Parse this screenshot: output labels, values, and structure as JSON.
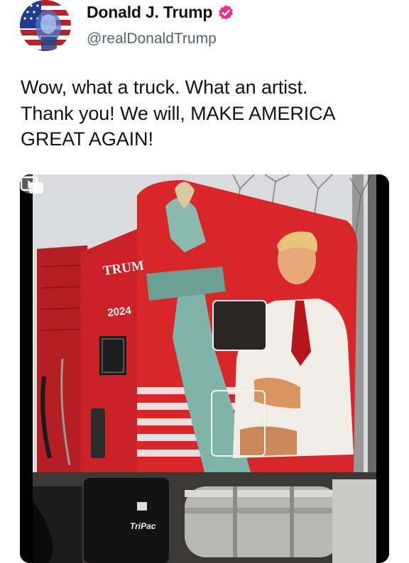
{
  "author": {
    "display_name": "Donald J. Trump",
    "handle": "@realDonaldTrump",
    "avatar_icon": "flag-portrait-avatar",
    "verified_icon": "verified-badge-icon",
    "verified_color": "#e8308c"
  },
  "tweet": {
    "lines": [
      "Wow, what a truck. What an artist.",
      "Thank you! We will, MAKE AMERICA",
      "GREAT AGAIN!"
    ]
  },
  "media": {
    "type": "video",
    "expand_icon": "expand-media-icon",
    "truck_lettering": [
      "TRUM",
      "2024",
      "TriPac"
    ],
    "colors": {
      "truck_red": "#d8262b",
      "sky": "#d9dbdc",
      "background": "#000000"
    }
  }
}
